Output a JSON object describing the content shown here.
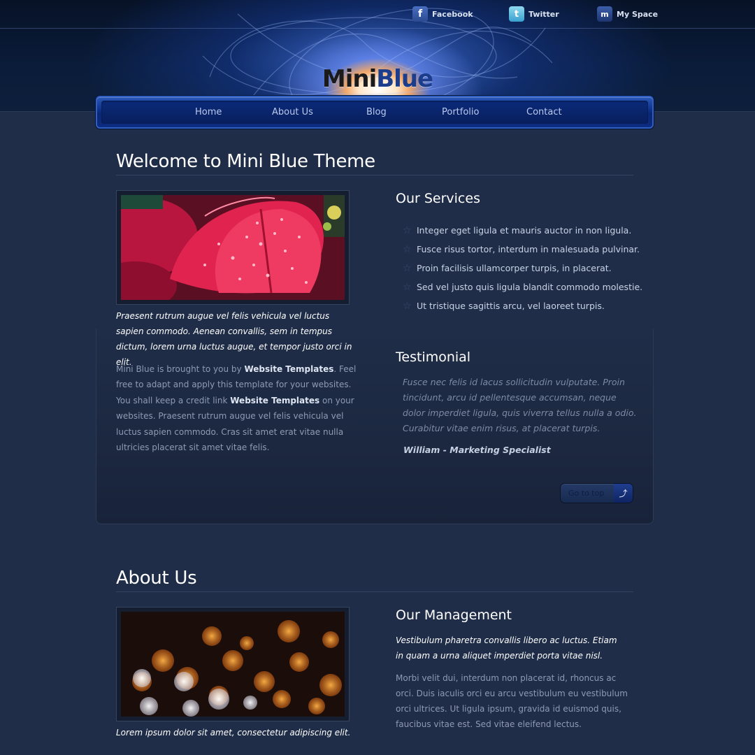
{
  "social": [
    {
      "label": "Facebook",
      "icon": "facebook-icon",
      "glyph": "f"
    },
    {
      "label": "Twitter",
      "icon": "twitter-icon",
      "glyph": "t"
    },
    {
      "label": "My Space",
      "icon": "myspace-icon",
      "glyph": "m"
    }
  ],
  "logo": {
    "part1": "Mini",
    "part2": "Blue"
  },
  "nav": [
    "Home",
    "About Us",
    "Blog",
    "Portfolio",
    "Contact"
  ],
  "welcome": {
    "title": "Welcome to Mini Blue Theme",
    "intro": "Praesent rutrum augue vel felis vehicula vel luctus sapien commodo. Aenean convallis, sem in tempus dictum, lorem urna luctus augue, et tempor justo orci in elit.",
    "body_1": "Mini Blue is brought to you by ",
    "link_1": "Website Templates",
    "body_2": ". Feel free to adapt and apply this template for your websites. You shall keep a credit link ",
    "link_2": "Website Templates",
    "body_3": " on your websites. Praesent rutrum augue vel felis vehicula vel luctus sapien commodo. Cras sit amet erat vitae nulla ultricies placerat sit amet vitae felis."
  },
  "services": {
    "title": "Our Services",
    "items": [
      "Integer eget ligula et mauris auctor in non ligula.",
      "Fusce risus tortor, interdum in malesuada pulvinar.",
      "Proin facilisis ullamcorper turpis, in placerat.",
      "Sed vel justo quis ligula blandit commodo molestie.",
      "Ut tristique sagittis arcu, vel laoreet turpis."
    ]
  },
  "testimonial": {
    "title": "Testimonial",
    "quote": "Fusce nec felis id lacus sollicitudin vulputate. Proin tincidunt, arcu id pellentesque accumsan, neque dolor imperdiet ligula, quis viverra tellus nulla a odio. Curabitur vitae enim risus, at placerat turpis.",
    "author": "William - Marketing Specialist"
  },
  "go_to_top": "Go to top",
  "about": {
    "title": "About Us",
    "caption": "Lorem ipsum dolor sit amet, consectetur adipiscing elit.",
    "management_title": "Our Management",
    "management_intro": "Vestibulum pharetra convallis libero ac luctus. Etiam in quam a urna aliquet imperdiet porta vitae nisl.",
    "management_body": "Morbi velit dui, interdum non placerat id, rhoncus ac orci. Duis iaculis orci eu arcu vestibulum eu vestibulum orci ultrices. Ut ligula ipsum, gravida id euismod quis, faucibus vitae est. Sed vitae eleifend lectus."
  },
  "colors": {
    "background": "#1f2d48",
    "nav": "#0a2775",
    "accent": "#2f5fc4"
  }
}
